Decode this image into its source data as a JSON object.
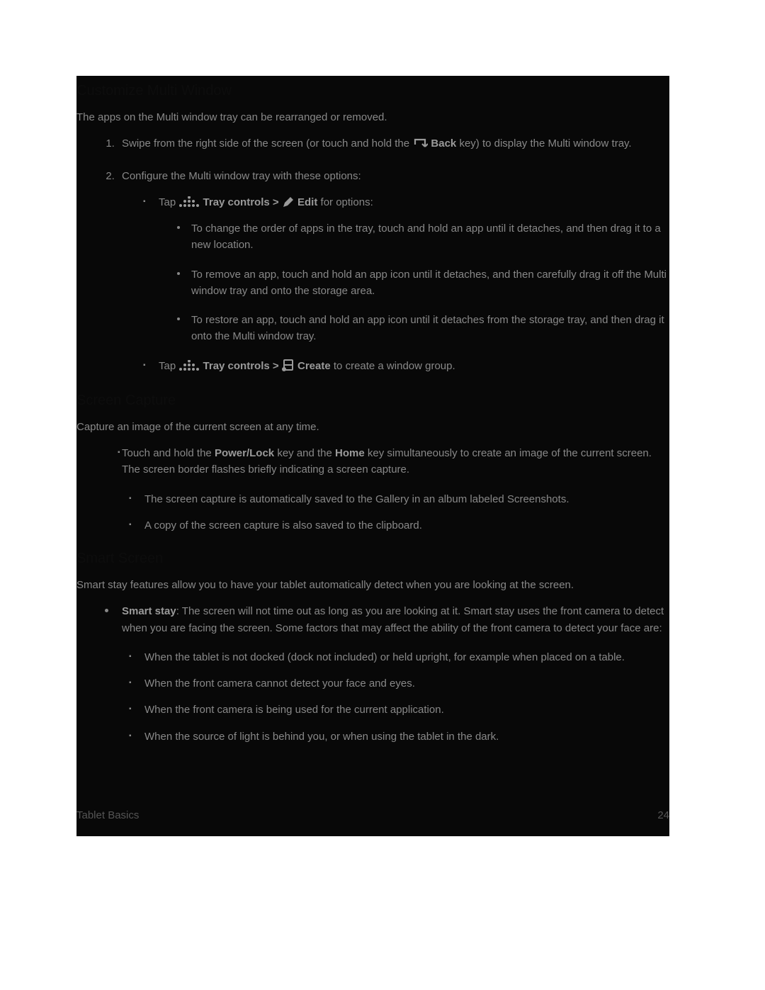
{
  "h_customize": "Customize Multi Window",
  "p_customize": "The apps on the Multi window tray can be rearranged or removed.",
  "step1_a": "Swipe from the right side of the screen (or touch and hold the ",
  "step1_back": "Back",
  "step1_b": " key) to display the Multi window tray.",
  "step2": "Configure the Multi window tray with these options:",
  "trayA_tap": "Tap ",
  "trayA_label": "Tray controls",
  "trayA_gt": " > ",
  "trayA_edit": "Edit",
  "trayA_rest": " for options:",
  "trayA_sub1": "To change the order of apps in the tray, touch and hold an app until it detaches, and then drag it to a new location.",
  "trayA_sub2": "To remove an app, touch and hold an app icon until it detaches, and then carefully drag it off the Multi window tray and onto the storage area.",
  "trayA_sub3": "To restore an app, touch and hold an app icon until it detaches from the storage tray, and then drag it onto the Multi window tray.",
  "trayB_tap": "Tap ",
  "trayB_label": "Tray controls",
  "trayB_gt": " > ",
  "trayB_create": "Create",
  "trayB_rest": " to create a window group.",
  "h_screen": "Screen Capture",
  "p_screen": "Capture an image of the current screen at any time.",
  "cap_a": "Touch and hold the ",
  "cap_power": "Power/Lock",
  "cap_b": " key and the ",
  "cap_home": "Home",
  "cap_c": " key simultaneously to create an image of the current screen. The screen border flashes briefly indicating a screen capture.",
  "cap_sub1": "The screen capture is automatically saved to the Gallery in an album labeled Screenshots.",
  "cap_sub2": "A copy of the screen capture is also saved to the clipboard.",
  "h_smart": "Smart Screen",
  "p_smart": "Smart stay features allow you to have your tablet automatically detect when you are looking at the screen.",
  "smart_label": "Smart stay",
  "smart_text": ": The screen will not time out as long as you are looking at it. Smart stay uses the front camera to detect when you are facing the screen. Some factors that may affect the ability of the front camera to detect your face are:",
  "smart_sub1": "When the tablet is not docked (dock not included) or held upright, for example when placed on a table.",
  "smart_sub2": "When the front camera cannot detect your face and eyes.",
  "smart_sub3": "When the front camera is being used for the current application.",
  "smart_sub4": "When the source of light is behind you, or when using the tablet in the dark.",
  "footer_left": "Tablet Basics",
  "footer_right": "24"
}
